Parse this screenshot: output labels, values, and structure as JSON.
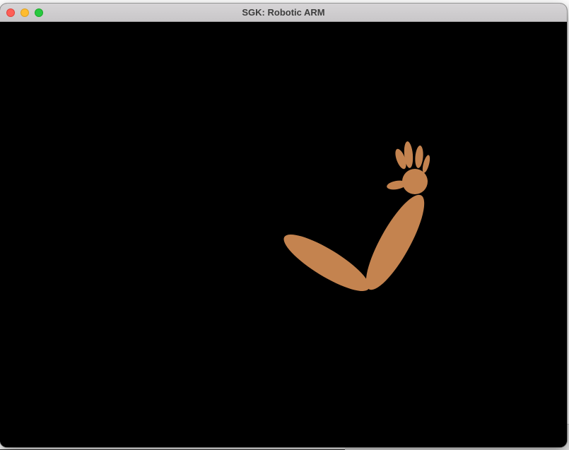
{
  "window": {
    "title": "SGK: Robotic ARM"
  },
  "scene": {
    "background_color": "#000000",
    "arm_color": "#c4834f",
    "parts": [
      {
        "name": "upper-arm",
        "shape": "ellipse"
      },
      {
        "name": "forearm",
        "shape": "ellipse"
      },
      {
        "name": "palm",
        "shape": "circle"
      },
      {
        "name": "thumb",
        "shape": "ellipse"
      },
      {
        "name": "finger-1",
        "shape": "ellipse"
      },
      {
        "name": "finger-2",
        "shape": "ellipse"
      },
      {
        "name": "finger-3",
        "shape": "ellipse"
      },
      {
        "name": "finger-4",
        "shape": "ellipse"
      }
    ]
  }
}
